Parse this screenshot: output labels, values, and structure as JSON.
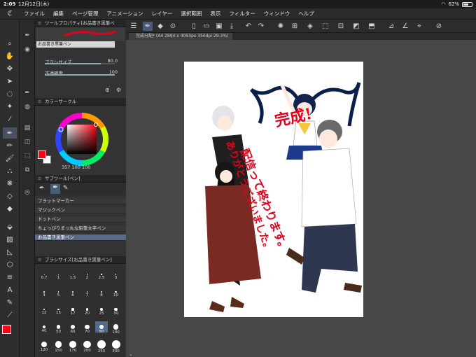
{
  "status_bar": {
    "time": "2:09",
    "date": "12月12日(木)",
    "battery": "62%"
  },
  "menu": {
    "items": [
      "ファイル",
      "編集",
      "ページ管理",
      "アニメーション",
      "レイヤー",
      "選択範囲",
      "表示",
      "フィルター",
      "ウィンドウ",
      "ヘルプ"
    ]
  },
  "tool_property": {
    "title": "ツールプロパティ[お品書き黒筆ペ",
    "brush_name": "お品書き黒筆ペン",
    "brush_size_label": "ブラシサイズ",
    "brush_size_value": "80.0",
    "opacity_label": "不透明度",
    "opacity_value": "100",
    "opacity_fraction": 1.0,
    "brush_size_fraction": 0.8
  },
  "color_circle": {
    "title": "カラーサークル",
    "fg_color": "#ff0010",
    "bg_color": "#ffffff",
    "hsv_readout": "357 100 100"
  },
  "sub_tool": {
    "title": "サブツール[ペン]",
    "items": [
      "フラットマーカー",
      "マジックペン",
      "ドットペン",
      "ちょっぴりまっ丸な鉛筆文字ペン",
      "お品書き黒筆ペン"
    ],
    "selected_index": 4
  },
  "brush_size_panel": {
    "title": "ブラシサイズ[お品書き黒筆ペン]",
    "sizes": [
      "0.7",
      "1",
      "1.5",
      "2",
      "2.5",
      "3",
      "4",
      "5",
      "6",
      "7",
      "8",
      "10",
      "12",
      "15",
      "17",
      "20",
      "25",
      "30",
      "40",
      "50",
      "60",
      "70",
      "80",
      "100",
      "120",
      "150",
      "170",
      "200",
      "250",
      "300"
    ],
    "selected": "80"
  },
  "canvas": {
    "tab_title": "完成分配* (A4 2894 x 4093px 350dpi 29.3%)",
    "text_line1": "完成!",
    "text_line2": "配信って終わります。",
    "text_line3": "ありがとうございました。"
  }
}
